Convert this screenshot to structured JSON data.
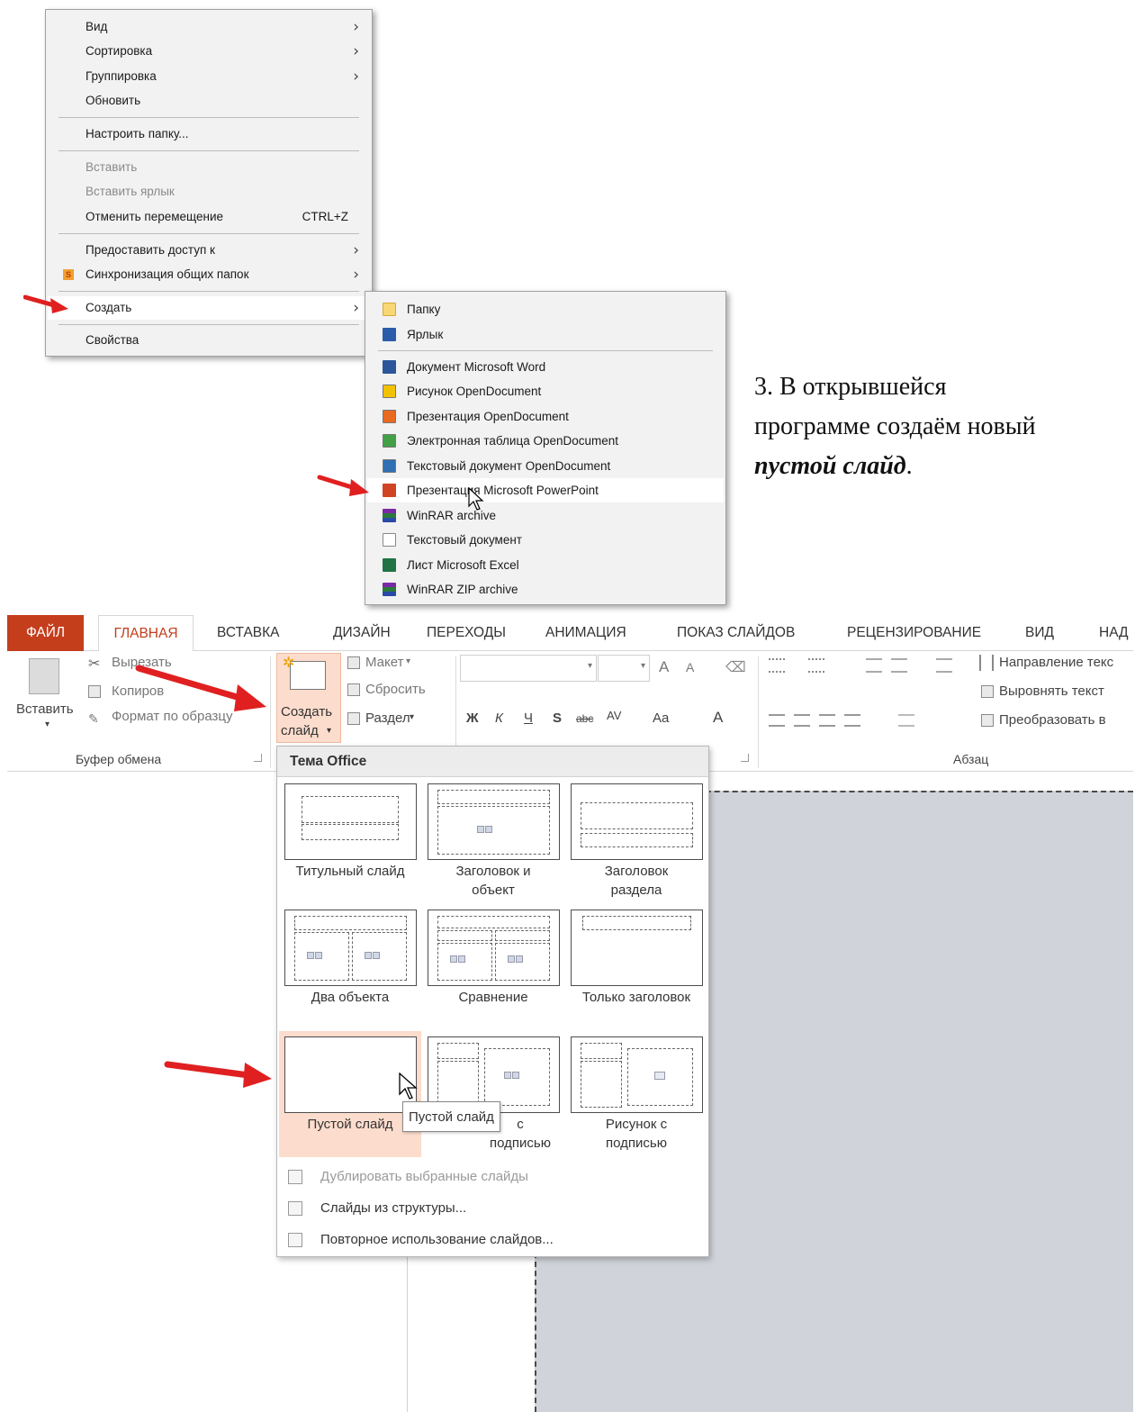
{
  "context_menu": {
    "items": [
      {
        "label": "Вид",
        "submenu": true
      },
      {
        "label": "Сортировка",
        "submenu": true
      },
      {
        "label": "Группировка",
        "submenu": true
      },
      {
        "label": "Обновить"
      },
      {
        "label": "Настроить папку..."
      },
      {
        "label": "Вставить",
        "disabled": true
      },
      {
        "label": "Вставить ярлык",
        "disabled": true
      },
      {
        "label": "Отменить перемещение",
        "accelerator": "CTRL+Z"
      },
      {
        "label": "Предоставить доступ к",
        "submenu": true
      },
      {
        "label": "Синхронизация общих папок",
        "submenu": true,
        "icon": "sync-folders-icon"
      },
      {
        "label": "Создать",
        "submenu": true,
        "highlighted": true
      },
      {
        "label": "Свойства"
      }
    ],
    "chevron": ">"
  },
  "new_submenu": {
    "items": [
      {
        "label": "Папку",
        "icon": "folder-icon"
      },
      {
        "label": "Ярлык",
        "icon": "shortcut-icon"
      },
      {
        "label": "Документ Microsoft Word",
        "icon": "word-icon"
      },
      {
        "label": "Рисунок OpenDocument",
        "icon": "odg-icon"
      },
      {
        "label": "Презентация OpenDocument",
        "icon": "odp-icon"
      },
      {
        "label": "Электронная таблица OpenDocument",
        "icon": "ods-icon"
      },
      {
        "label": "Текстовый документ OpenDocument",
        "icon": "odt-icon"
      },
      {
        "label": "Презентация Microsoft PowerPoint",
        "icon": "powerpoint-icon",
        "highlighted": true
      },
      {
        "label": "WinRAR archive",
        "icon": "winrar-icon"
      },
      {
        "label": "Текстовый документ",
        "icon": "text-file-icon"
      },
      {
        "label": "Лист Microsoft Excel",
        "icon": "excel-icon"
      },
      {
        "label": "WinRAR ZIP archive",
        "icon": "winrar-zip-icon"
      }
    ]
  },
  "instruction": {
    "line1": "3.  В открывшейся",
    "line2": "программе создаём новый",
    "line3_bold": "пустой слайд",
    "line3_end": "."
  },
  "ribbon": {
    "tabs": [
      "ФАЙЛ",
      "ГЛАВНАЯ",
      "ВСТАВКА",
      "ДИЗАЙН",
      "ПЕРЕХОДЫ",
      "АНИМАЦИЯ",
      "ПОКАЗ СЛАЙДОВ",
      "РЕЦЕНЗИРОВАНИЕ",
      "ВИД",
      "НАД"
    ],
    "active_tab": "ГЛАВНАЯ",
    "clipboard": {
      "paste": "Вставить",
      "cut": "Вырезать",
      "copy": "Копиров",
      "format_painter": "Формат по образцу",
      "group": "Буфер обмена"
    },
    "slides": {
      "new_slide_line1": "Создать",
      "new_slide_line2": "слайд",
      "layout": "Макет",
      "reset": "Сбросить",
      "section": "Раздел"
    },
    "font": {
      "bold": "Ж",
      "italic": "К",
      "underline": "Ч",
      "shadow": "S",
      "strike": "abc",
      "spacing": "AV",
      "case": "Aa",
      "color": "A",
      "grow": "A",
      "shrink": "A"
    },
    "paragraph": {
      "text_direction": "Направление текс",
      "align_text": "Выровнять текст",
      "convert": "Преобразовать в",
      "group": "Абзац"
    },
    "accent_color": "#c43e1c"
  },
  "layout_gallery": {
    "header": "Тема Office",
    "layouts": [
      {
        "caption": "Титульный слайд"
      },
      {
        "caption": "Заголовок и\nобъект"
      },
      {
        "caption": "Заголовок\nраздела"
      },
      {
        "caption": "Два объекта"
      },
      {
        "caption": "Сравнение"
      },
      {
        "caption": "Только заголовок"
      },
      {
        "caption": "Пустой слайд",
        "selected": true
      },
      {
        "caption": "с\nподписью"
      },
      {
        "caption": "Рисунок с\nподписью"
      }
    ],
    "tooltip": "Пустой слайд",
    "commands": [
      {
        "label": "Дублировать выбранные слайды",
        "disabled": true
      },
      {
        "label": "Слайды из структуры..."
      },
      {
        "label": "Повторное использование слайдов..."
      }
    ]
  }
}
